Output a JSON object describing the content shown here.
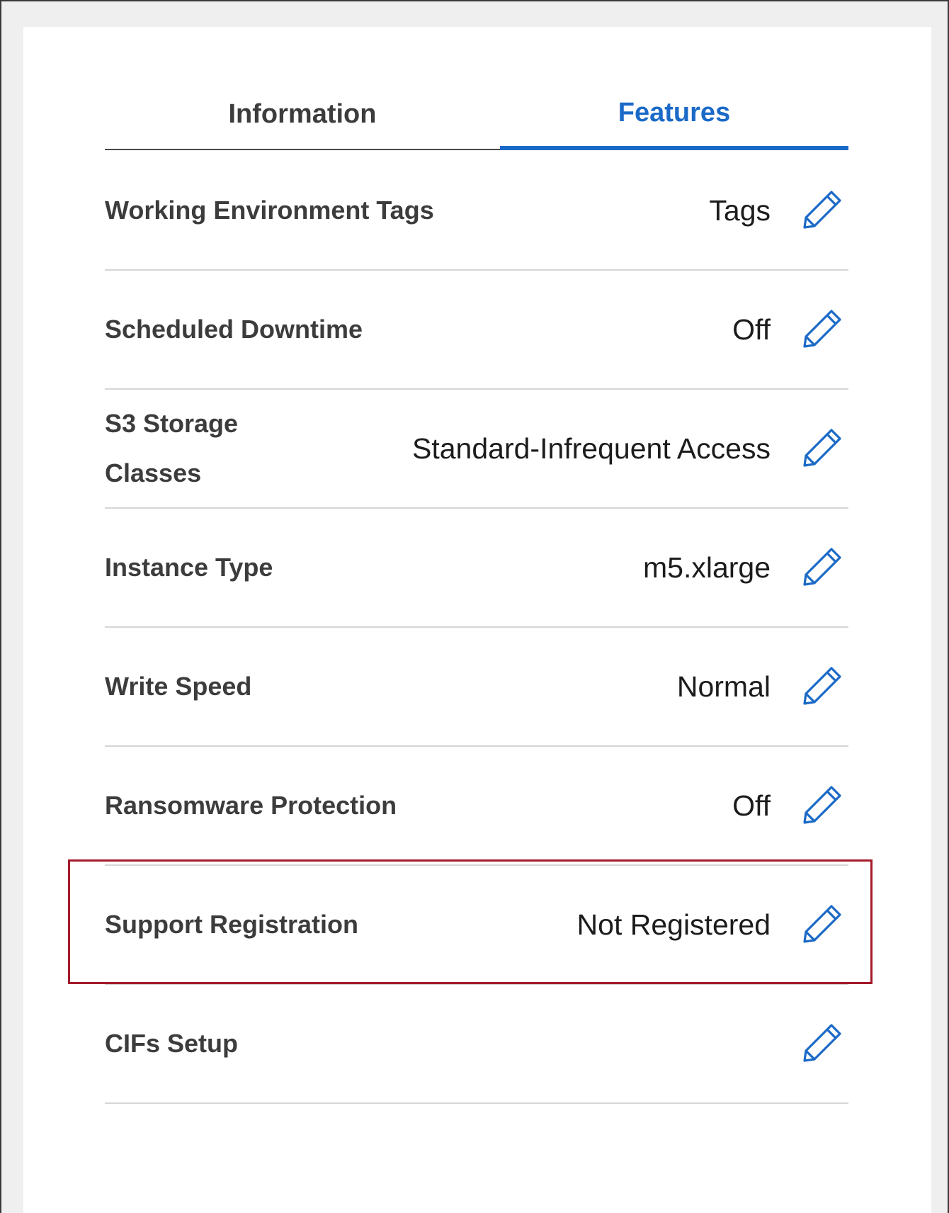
{
  "tabs": [
    {
      "label": "Information",
      "active": false
    },
    {
      "label": "Features",
      "active": true
    }
  ],
  "rows": [
    {
      "label": "Working Environment Tags",
      "value": "Tags"
    },
    {
      "label": "Scheduled Downtime",
      "value": "Off"
    },
    {
      "label": "S3 Storage Classes",
      "value": "Standard-Infrequent Access"
    },
    {
      "label": "Instance Type",
      "value": "m5.xlarge"
    },
    {
      "label": "Write Speed",
      "value": "Normal"
    },
    {
      "label": "Ransomware Protection",
      "value": "Off"
    },
    {
      "label": "Support Registration",
      "value": "Not Registered"
    },
    {
      "label": "CIFs Setup",
      "value": ""
    }
  ],
  "colors": {
    "accent": "#1b6ac7",
    "highlight_border": "#a31a2a",
    "divider": "#d6d6d6"
  },
  "icons": {
    "edit": "pencil-icon"
  }
}
